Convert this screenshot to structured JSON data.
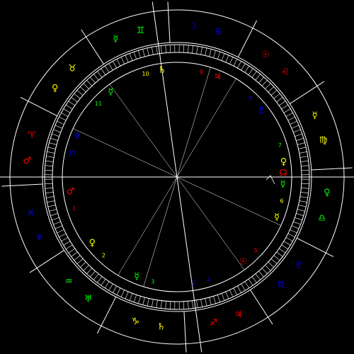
{
  "colors": {
    "background": "#000000",
    "lines": "#ffffff",
    "fire": "#ff0000",
    "earth": "#ffff00",
    "air": "#00ff00",
    "water": "#0000ff"
  },
  "signs": [
    {
      "name": "aries-icon",
      "glyph": "♈",
      "color": "#ff0000",
      "ruler": {
        "name": "mars-icon",
        "glyph": "♂",
        "color": "#ff0000"
      }
    },
    {
      "name": "taurus-icon",
      "glyph": "♉",
      "color": "#ffff00",
      "ruler": {
        "name": "venus-icon",
        "glyph": "♀",
        "color": "#ffff00"
      }
    },
    {
      "name": "gemini-icon",
      "glyph": "♊",
      "color": "#00ff00",
      "ruler": {
        "name": "mercury-icon",
        "glyph": "☿",
        "color": "#00ff00"
      }
    },
    {
      "name": "cancer-icon",
      "glyph": "♋",
      "color": "#0000ff",
      "ruler": {
        "name": "moon-icon",
        "glyph": "☽",
        "color": "#0000ff"
      }
    },
    {
      "name": "leo-icon",
      "glyph": "♌",
      "color": "#ff0000",
      "ruler": {
        "name": "sun-icon",
        "glyph": "☉",
        "color": "#ff0000"
      }
    },
    {
      "name": "virgo-icon",
      "glyph": "♍",
      "color": "#ffff00",
      "ruler": {
        "name": "mercury-icon",
        "glyph": "☿",
        "color": "#ffff00"
      }
    },
    {
      "name": "libra-icon",
      "glyph": "♎",
      "color": "#00ff00",
      "ruler": {
        "name": "venus-icon",
        "glyph": "♀",
        "color": "#00ff00"
      }
    },
    {
      "name": "scorpio-icon",
      "glyph": "♏",
      "color": "#0000ff",
      "ruler": {
        "name": "pluto-icon",
        "glyph": "♇",
        "color": "#0000ff"
      }
    },
    {
      "name": "sagittarius-icon",
      "glyph": "♐",
      "color": "#ff0000",
      "ruler": {
        "name": "jupiter-icon",
        "glyph": "♃",
        "color": "#ff0000"
      }
    },
    {
      "name": "capricorn-icon",
      "glyph": "♑",
      "color": "#ffff00",
      "ruler": {
        "name": "saturn-icon",
        "glyph": "♄",
        "color": "#ffff00"
      }
    },
    {
      "name": "aquarius-icon",
      "glyph": "♒",
      "color": "#00ff00",
      "ruler": {
        "name": "uranus-icon",
        "glyph": "♅",
        "color": "#00ff00"
      }
    },
    {
      "name": "pisces-icon",
      "glyph": "♓",
      "color": "#0000ff",
      "ruler": {
        "name": "neptune-icon",
        "glyph": "♆",
        "color": "#0000ff"
      }
    }
  ],
  "houses": [
    {
      "number": "1",
      "color": "#ff0000",
      "sign_glyph": "♂",
      "sign_color": "#ff0000"
    },
    {
      "number": "2",
      "color": "#ffff00",
      "sign_glyph": "♀",
      "sign_color": "#ffff00"
    },
    {
      "number": "3",
      "color": "#00ff00",
      "sign_glyph": "☿",
      "sign_color": "#00ff00"
    },
    {
      "number": "4",
      "color": "#0000ff",
      "sign_glyph": "☽",
      "sign_color": "#0000ff"
    },
    {
      "number": "5",
      "color": "#ff0000",
      "sign_glyph": "☉",
      "sign_color": "#ff0000"
    },
    {
      "number": "6",
      "color": "#ffff00",
      "sign_glyph": "☿",
      "sign_color": "#ffff00"
    },
    {
      "number": "7",
      "color": "#00ff00",
      "sign_glyph": "♀",
      "sign_color": "#ffff00"
    },
    {
      "number": "8",
      "color": "#0000ff",
      "sign_glyph": "♇",
      "sign_color": "#0000ff"
    },
    {
      "number": "9",
      "color": "#ff0000",
      "sign_glyph": "♃",
      "sign_color": "#ff0000"
    },
    {
      "number": "10",
      "color": "#ffff00",
      "sign_glyph": "♄",
      "sign_color": "#ffff00"
    },
    {
      "number": "11",
      "color": "#00ff00",
      "sign_glyph": "☿",
      "sign_color": "#00ff00"
    },
    {
      "number": "12",
      "color": "#0000ff",
      "sign_glyph": "♆",
      "sign_color": "#0000ff"
    }
  ],
  "planets": [
    {
      "name": "north-node-icon",
      "glyph": "☊",
      "color": "#ff0000"
    },
    {
      "name": "mercury-planet-icon",
      "glyph": "☿",
      "color": "#00ff00"
    }
  ]
}
